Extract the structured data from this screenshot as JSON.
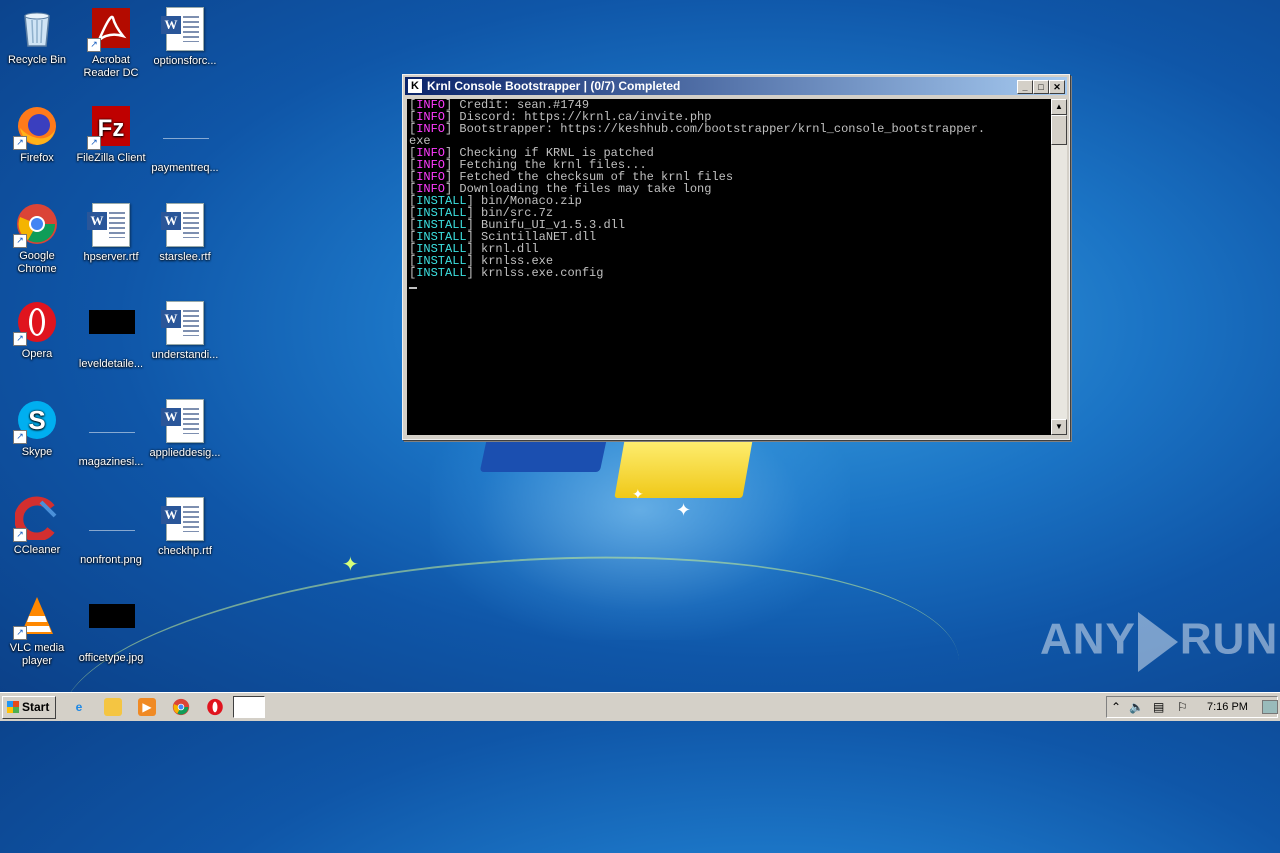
{
  "desktop": {
    "icons": [
      {
        "label": "Recycle Bin",
        "icon": "recycle-bin-icon"
      },
      {
        "label": "Acrobat Reader DC",
        "icon": "acrobat-icon"
      },
      {
        "label": "optionsforc...",
        "icon": "word-doc-icon"
      },
      {
        "label": "Firefox",
        "icon": "firefox-icon"
      },
      {
        "label": "FileZilla Client",
        "icon": "filezilla-icon"
      },
      {
        "label": "paymentreq...",
        "icon": "blank-file-icon"
      },
      {
        "label": "Google Chrome",
        "icon": "chrome-icon"
      },
      {
        "label": "hpserver.rtf",
        "icon": "word-doc-icon"
      },
      {
        "label": "starslee.rtf",
        "icon": "word-doc-icon"
      },
      {
        "label": "Opera",
        "icon": "opera-icon"
      },
      {
        "label": "leveldetaile...",
        "icon": "black-image-icon"
      },
      {
        "label": "understandi...",
        "icon": "word-doc-icon"
      },
      {
        "label": "Skype",
        "icon": "skype-icon"
      },
      {
        "label": "magazinesi...",
        "icon": "blank-file-icon"
      },
      {
        "label": "applieddesig...",
        "icon": "word-doc-icon"
      },
      {
        "label": "CCleaner",
        "icon": "ccleaner-icon"
      },
      {
        "label": "nonfront.png",
        "icon": "blank-file-icon"
      },
      {
        "label": "checkhp.rtf",
        "icon": "word-doc-icon"
      },
      {
        "label": "VLC media player",
        "icon": "vlc-icon"
      },
      {
        "label": "officetype.jpg",
        "icon": "black-image-icon"
      }
    ]
  },
  "console_window": {
    "title": "Krnl Console Bootstrapper | (0/7) Completed",
    "app_icon_letter": "K",
    "buttons": {
      "minimize": "_",
      "maximize": "□",
      "close": "✕"
    },
    "lines": [
      {
        "tag": "INFO",
        "text": " Credit: sean.#1749"
      },
      {
        "tag": "INFO",
        "text": " Discord: https://krnl.ca/invite.php"
      },
      {
        "tag": "INFO",
        "text": " Bootstrapper: https://keshhub.com/bootstrapper/krnl_console_bootstrapper."
      },
      {
        "tag": "",
        "text": "exe"
      },
      {
        "tag": "INFO",
        "text": " Checking if KRNL is patched"
      },
      {
        "tag": "INFO",
        "text": " Fetching the krnl files..."
      },
      {
        "tag": "INFO",
        "text": " Fetched the checksum of the krnl files"
      },
      {
        "tag": "INFO",
        "text": " Downloading the files may take long"
      },
      {
        "tag": "INSTALL",
        "text": " bin/Monaco.zip"
      },
      {
        "tag": "INSTALL",
        "text": " bin/src.7z"
      },
      {
        "tag": "INSTALL",
        "text": " Bunifu_UI_v1.5.3.dll"
      },
      {
        "tag": "INSTALL",
        "text": " ScintillaNET.dll"
      },
      {
        "tag": "INSTALL",
        "text": " krnl.dll"
      },
      {
        "tag": "INSTALL",
        "text": " krnlss.exe"
      },
      {
        "tag": "INSTALL",
        "text": " krnlss.exe.config"
      }
    ]
  },
  "watermark": {
    "left": "ANY",
    "right": "RUN"
  },
  "taskbar": {
    "start_label": "Start",
    "quick_launch": [
      "internet-explorer-icon",
      "file-explorer-icon",
      "media-player-icon",
      "chrome-icon",
      "opera-icon"
    ],
    "clock": "7:16 PM"
  },
  "colors": {
    "info_tag": "#ff3cff",
    "install_tag": "#3ce0e0",
    "console_bg": "#000000",
    "title_bar": "#0a246a"
  }
}
